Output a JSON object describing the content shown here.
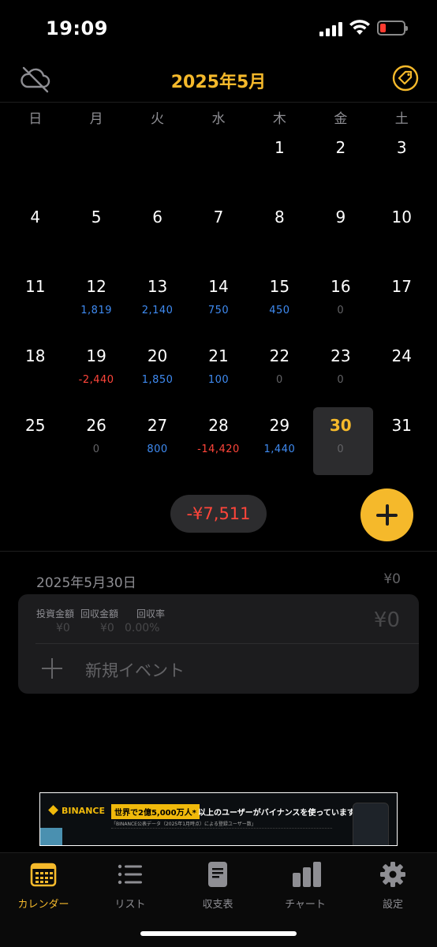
{
  "status": {
    "time": "19:09"
  },
  "header": {
    "title": "2025年5月"
  },
  "weekdays": [
    "日",
    "月",
    "火",
    "水",
    "木",
    "金",
    "土"
  ],
  "weeks": [
    [
      {
        "d": ""
      },
      {
        "d": ""
      },
      {
        "d": ""
      },
      {
        "d": ""
      },
      {
        "d": "1"
      },
      {
        "d": "2"
      },
      {
        "d": "3"
      }
    ],
    [
      {
        "d": "4"
      },
      {
        "d": "5"
      },
      {
        "d": "6"
      },
      {
        "d": "7"
      },
      {
        "d": "8"
      },
      {
        "d": "9"
      },
      {
        "d": "10"
      }
    ],
    [
      {
        "d": "11"
      },
      {
        "d": "12",
        "v": "1,819",
        "t": "pos"
      },
      {
        "d": "13",
        "v": "2,140",
        "t": "pos"
      },
      {
        "d": "14",
        "v": "750",
        "t": "pos"
      },
      {
        "d": "15",
        "v": "450",
        "t": "pos"
      },
      {
        "d": "16",
        "v": "0",
        "t": "zero"
      },
      {
        "d": "17"
      }
    ],
    [
      {
        "d": "18"
      },
      {
        "d": "19",
        "v": "-2,440",
        "t": "neg"
      },
      {
        "d": "20",
        "v": "1,850",
        "t": "pos"
      },
      {
        "d": "21",
        "v": "100",
        "t": "pos"
      },
      {
        "d": "22",
        "v": "0",
        "t": "zero"
      },
      {
        "d": "23",
        "v": "0",
        "t": "zero"
      },
      {
        "d": "24"
      }
    ],
    [
      {
        "d": "25"
      },
      {
        "d": "26",
        "v": "0",
        "t": "zero"
      },
      {
        "d": "27",
        "v": "800",
        "t": "pos"
      },
      {
        "d": "28",
        "v": "-14,420",
        "t": "neg"
      },
      {
        "d": "29",
        "v": "1,440",
        "t": "pos"
      },
      {
        "d": "30",
        "v": "0",
        "t": "zero",
        "selected": true
      },
      {
        "d": "31"
      }
    ]
  ],
  "summary": {
    "total": "-¥7,511"
  },
  "detail": {
    "date": "2025年5月30日",
    "total": "¥0",
    "invest_label": "投資金額",
    "invest_value": "¥0",
    "return_label": "回収金額",
    "return_value": "¥0",
    "rate_label": "回収率",
    "rate_value": "0.00%",
    "amount": "¥0",
    "new_event": "新規イベント"
  },
  "ad": {
    "brand": "BINANCE",
    "highlight": "世界で2億5,000万人*",
    "headline": "以上のユーザーがバイナンスを使っています。",
    "sub": "「BINANCE公表データ（2025年1月時点）による登録ユーザー数」"
  },
  "tabs": [
    {
      "label": "カレンダー",
      "icon": "calendar-icon",
      "active": true
    },
    {
      "label": "リスト",
      "icon": "list-icon"
    },
    {
      "label": "収支表",
      "icon": "document-icon"
    },
    {
      "label": "チャート",
      "icon": "bar-chart-icon"
    },
    {
      "label": "設定",
      "icon": "gear-icon"
    }
  ],
  "colors": {
    "accent": "#f5b92b",
    "positive": "#3f8bf2",
    "negative": "#ff453a",
    "zero": "#636366"
  }
}
